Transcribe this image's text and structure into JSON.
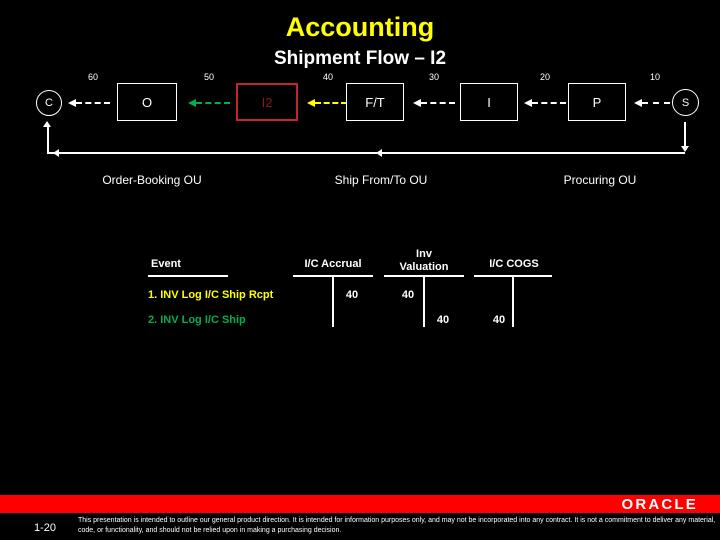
{
  "slide": {
    "title": "Accounting",
    "subtitle": "Shipment Flow – I2",
    "title_color": "#ffff00",
    "subtitle_color": "#ffffff",
    "background": "#000000"
  },
  "flow": {
    "nodes": [
      {
        "label": "C",
        "shape": "circle",
        "style": "plain"
      },
      {
        "label": "O",
        "shape": "box",
        "style": "plain"
      },
      {
        "label": "I2",
        "shape": "box",
        "style": "highlight"
      },
      {
        "label": "F/T",
        "shape": "box",
        "style": "plain"
      },
      {
        "label": "I",
        "shape": "box",
        "style": "plain"
      },
      {
        "label": "P",
        "shape": "box",
        "style": "plain"
      },
      {
        "label": "S",
        "shape": "circle",
        "style": "plain"
      }
    ],
    "arrows": [
      {
        "amount": "60",
        "color": "#ffffff"
      },
      {
        "amount": "50",
        "color": "#00b050"
      },
      {
        "amount": "40",
        "color": "#ffff00"
      },
      {
        "amount": "30",
        "color": "#ffffff"
      },
      {
        "amount": "20",
        "color": "#ffffff"
      },
      {
        "amount": "10",
        "color": "#ffffff"
      }
    ]
  },
  "ou_spans": [
    {
      "label": "Order-Booking OU"
    },
    {
      "label": "Ship From/To OU"
    },
    {
      "label": "Procuring OU"
    }
  ],
  "table": {
    "columns": [
      {
        "header": "Event"
      },
      {
        "header": "I/C Accrual"
      },
      {
        "header_line1": "Inv",
        "header_line2": "Valuation"
      },
      {
        "header": "I/C COGS"
      }
    ],
    "rows": [
      {
        "event": "1. INV Log I/C Ship Rcpt",
        "color": "#ffff00",
        "ic_accrual_credit": "40",
        "inv_valuation_debit": "40",
        "inv_valuation_credit": "",
        "ic_cogs_debit": ""
      },
      {
        "event": "2. INV Log I/C Ship",
        "color": "#00b050",
        "ic_accrual_credit": "",
        "inv_valuation_debit": "",
        "inv_valuation_credit": "40",
        "ic_cogs_debit": "40"
      }
    ]
  },
  "footer": {
    "brand": "ORACLE",
    "page_number": "1-20",
    "disclaimer": "This presentation is intended to outline our general product direction.  It is intended for information purposes only, and may not be incorporated into any contract. It is not a commitment to deliver any material, code, or functionality, and should not be relied upon in making a purchasing decision.",
    "bar_color": "#ff0000"
  }
}
